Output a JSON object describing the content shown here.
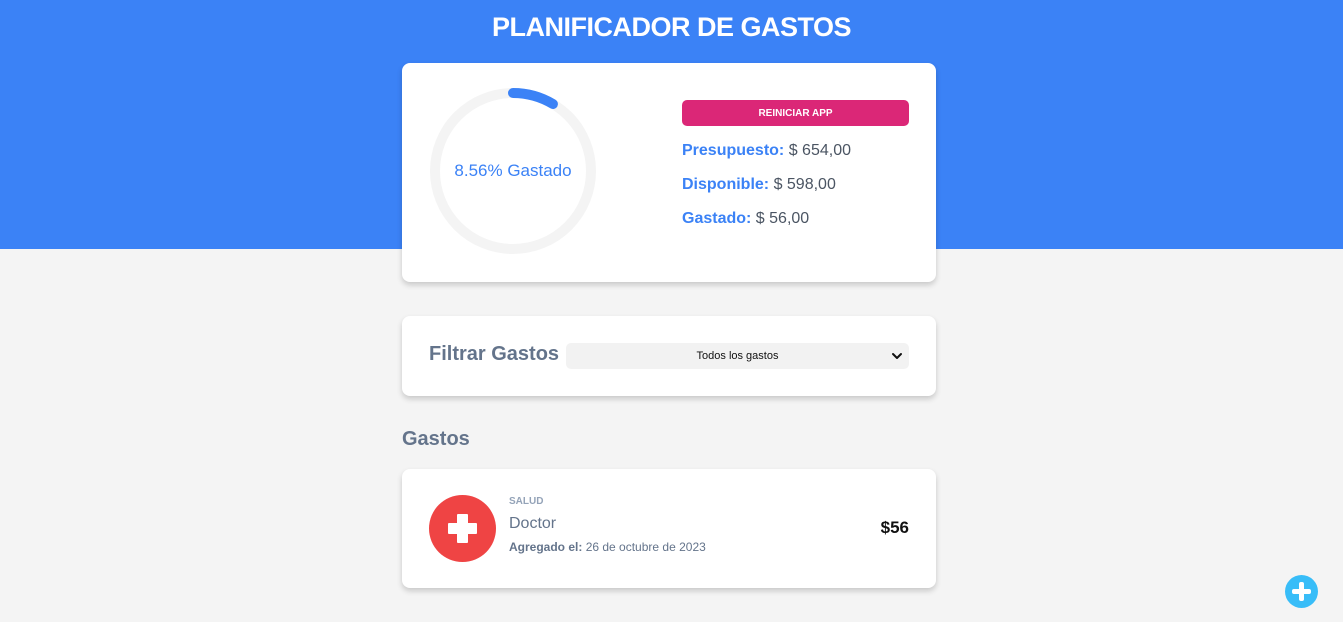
{
  "header": {
    "title": "PLANIFICADOR DE GASTOS",
    "accent_color": "#3b82f6"
  },
  "budget": {
    "progress_percent": 8.56,
    "progress_label": "8.56% Gastado",
    "reset_label": "REINICIAR APP",
    "presupuesto_label": "Presupuesto:",
    "presupuesto_value": "$ 654,00",
    "disponible_label": "Disponible:",
    "disponible_value": "$ 598,00",
    "gastado_label": "Gastado:",
    "gastado_value": "$ 56,00"
  },
  "filter": {
    "label": "Filtrar Gastos",
    "selected": "Todos los gastos"
  },
  "expenses": {
    "title": "Gastos",
    "items": [
      {
        "category": "SALUD",
        "icon": "health-cross-icon",
        "name": "Doctor",
        "date_label": "Agregado el:",
        "date_value": "26 de octubre de 2023",
        "amount": "$56"
      }
    ]
  },
  "add_button": {
    "icon": "plus-icon",
    "color": "#38bdf8"
  }
}
